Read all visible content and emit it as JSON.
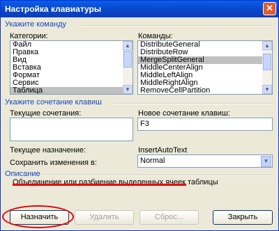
{
  "window": {
    "title": "Настройка клавиатуры",
    "close_glyph": "✕"
  },
  "sections": {
    "command": "Укажите команду",
    "shortcut": "Укажите сочетание клавиш",
    "description": "Описание"
  },
  "categories": {
    "label": "Категории:",
    "items": [
      "Файл",
      "Правка",
      "Вид",
      "Вставка",
      "Формат",
      "Сервис",
      "Таблица"
    ],
    "selected": "Таблица"
  },
  "commands": {
    "label": "Команды:",
    "items": [
      "DistributeGeneral",
      "DistributeRow",
      "MergeSplitGeneral",
      "MiddleCenterAlign",
      "MiddleLeftAlign",
      "MiddleRightAlign",
      "RemoveCellPartition"
    ],
    "selected": "MergeSplitGeneral"
  },
  "current_keys": {
    "label": "Текущие сочетания:"
  },
  "new_shortcut": {
    "label": "Новое сочетание клавиш:",
    "value": "F3"
  },
  "current_assignment": {
    "label": "Текущее назначение:",
    "value": "InsertAutoText"
  },
  "save_in": {
    "label": "Сохранить изменения в:",
    "value": "Normal"
  },
  "description_text": "Объединение или разбиение выделенных ячеек таблицы",
  "buttons": {
    "assign": "Назначить",
    "remove": "Удалить",
    "reset": "Сброс...",
    "close": "Закрыть"
  }
}
